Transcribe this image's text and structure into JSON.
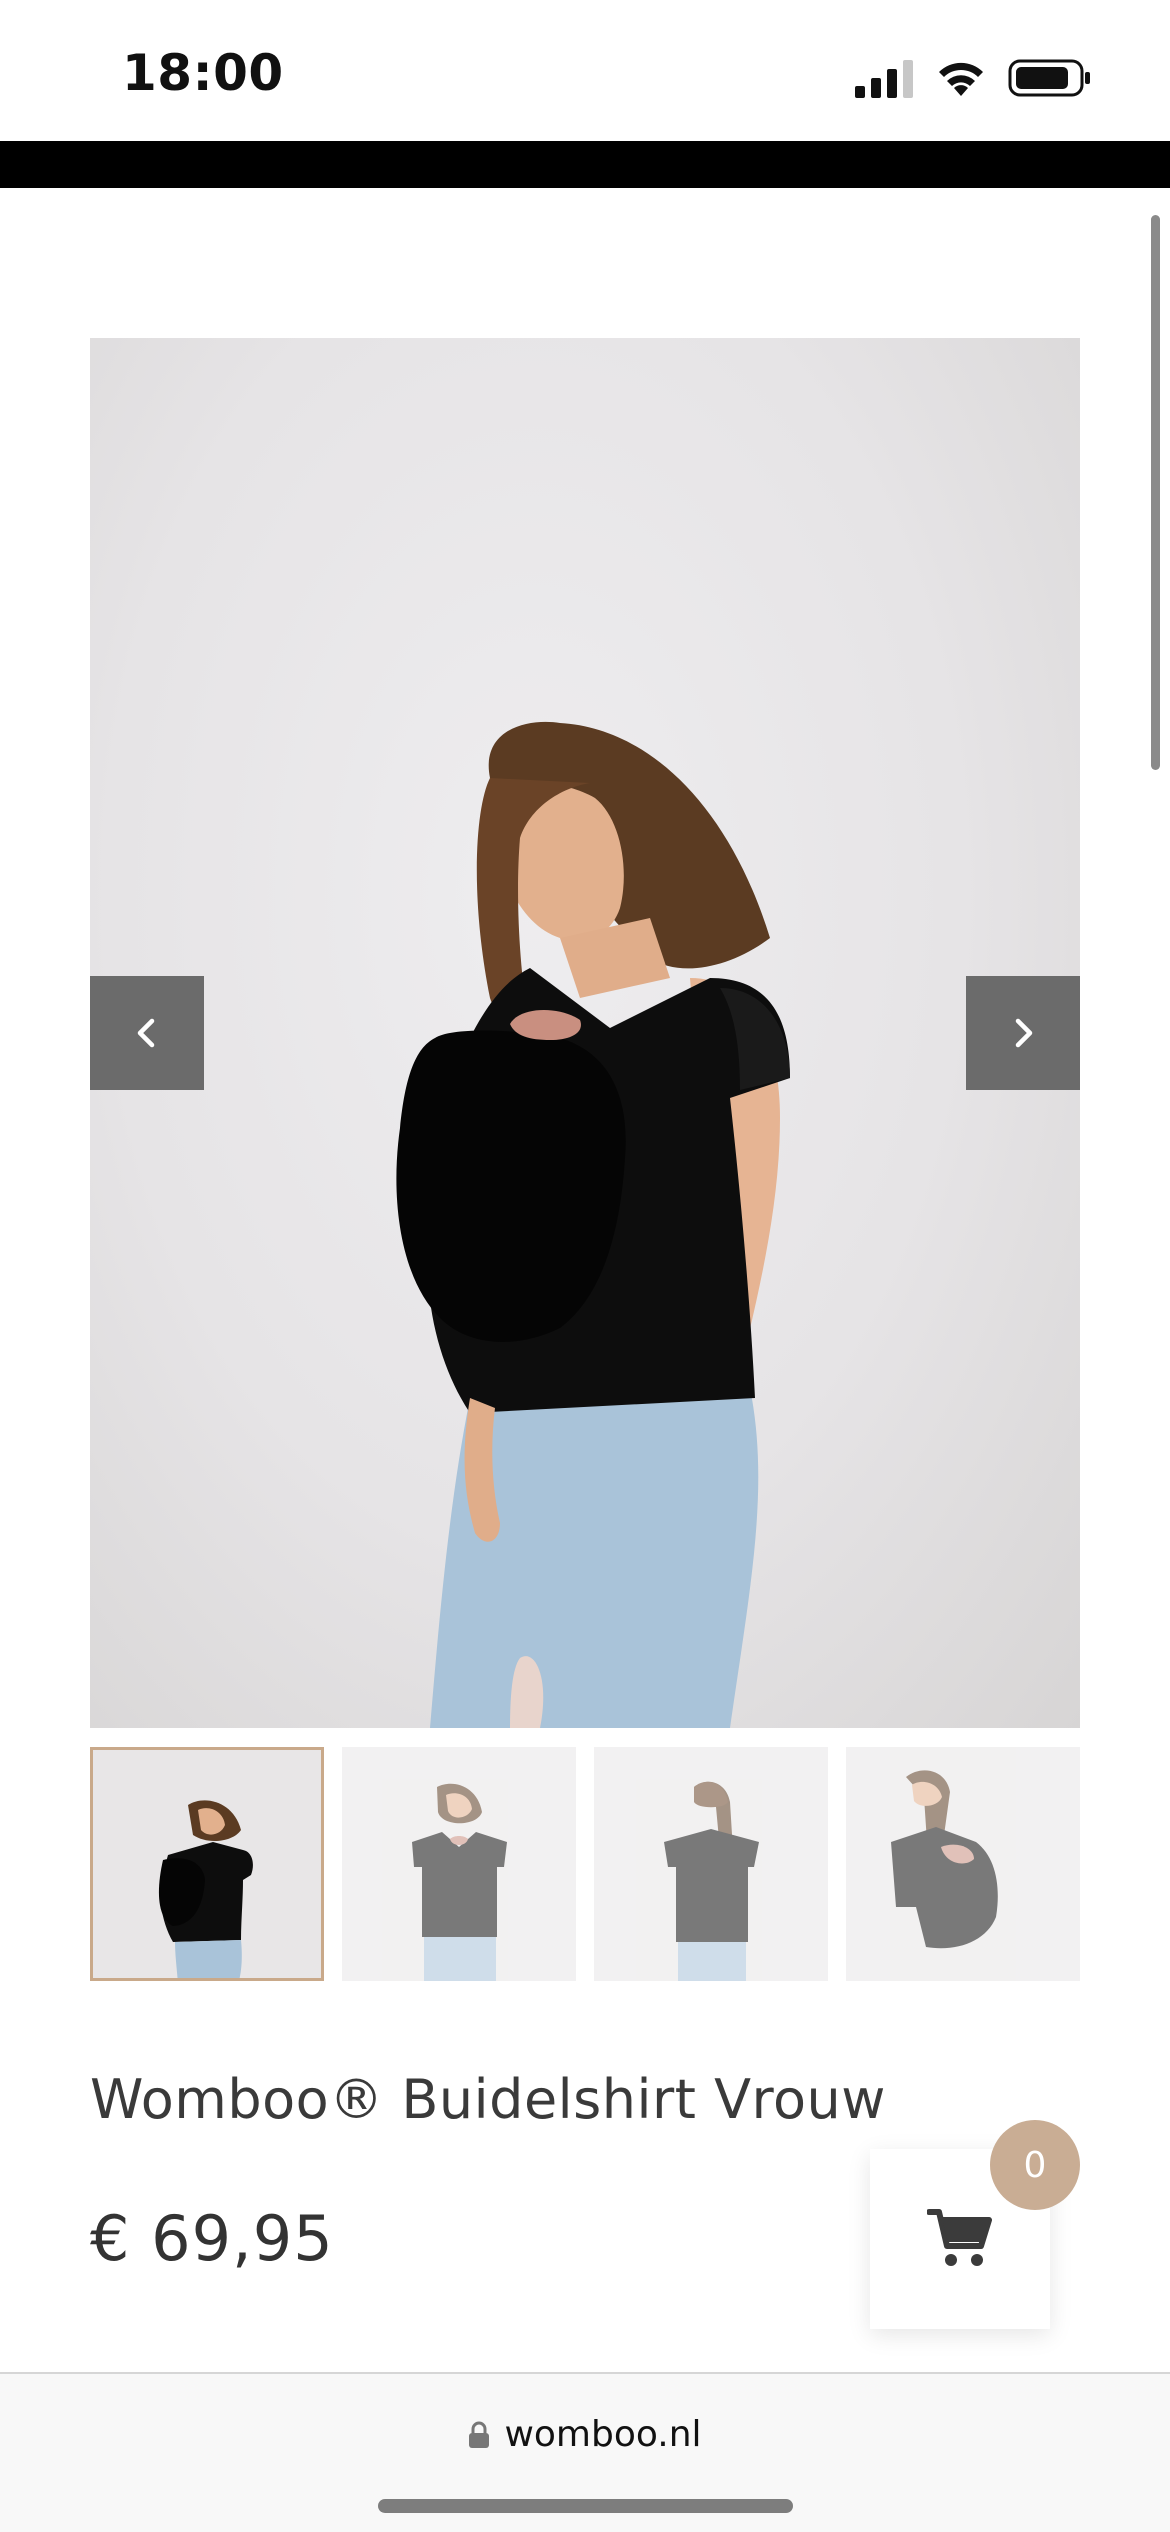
{
  "status_bar": {
    "time": "18:00"
  },
  "product": {
    "title": "Womboo® Buidelshirt Vrouw",
    "price": "€ 69,95",
    "image_alt": "Woman wearing black Womboo pouch shirt carrying baby",
    "thumbnails": [
      {
        "name": "side view with baby",
        "active": true
      },
      {
        "name": "front view with baby",
        "active": false
      },
      {
        "name": "back view",
        "active": false
      },
      {
        "name": "side view holding baby",
        "active": false
      }
    ]
  },
  "slider": {
    "prev_icon": "chevron-left-icon",
    "next_icon": "chevron-right-icon"
  },
  "cart": {
    "count": "0",
    "icon": "shopping-cart-icon",
    "badge_color": "#c9ad94"
  },
  "browser": {
    "url": "womboo.nl",
    "lock_icon": "lock-icon"
  },
  "colors": {
    "accent": "#c9a98a",
    "arrow_bg": "#6b6b6b",
    "shirt": "#0d0d0d",
    "jeans": "#a9c3d9"
  }
}
